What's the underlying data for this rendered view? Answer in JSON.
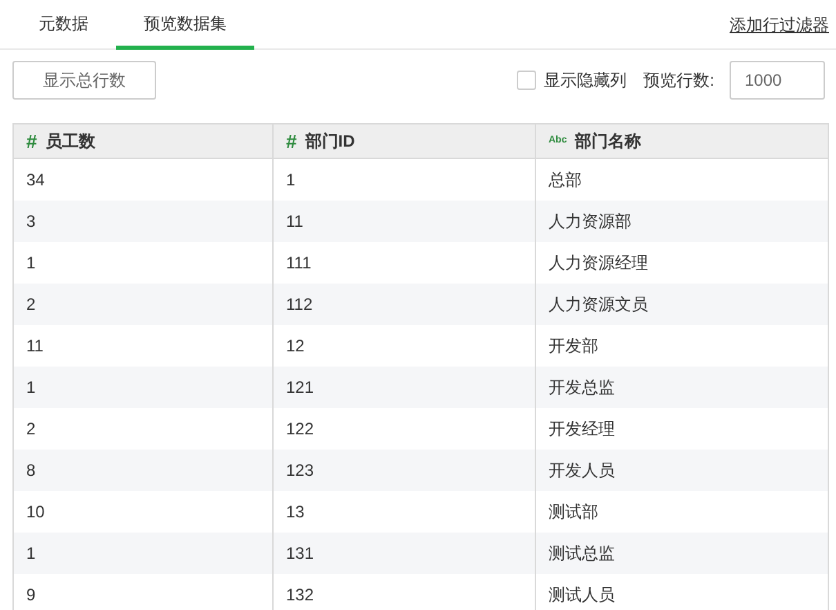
{
  "tabs": [
    {
      "label": "元数据",
      "selected": false
    },
    {
      "label": "预览数据集",
      "selected": true
    }
  ],
  "add_filter_link": "添加行过滤器",
  "toolbar": {
    "show_total_button": "显示总行数",
    "show_hidden_columns": {
      "label": "显示隐藏列",
      "checked": false
    },
    "preview_rows": {
      "label": "预览行数:",
      "value": "1000"
    }
  },
  "table": {
    "columns": [
      {
        "label": "员工数",
        "kind": "number",
        "type_mark": "#"
      },
      {
        "label": "部门ID",
        "kind": "number",
        "type_mark": "#"
      },
      {
        "label": "部门名称",
        "kind": "text",
        "type_mark": "Abc"
      }
    ],
    "rows": [
      [
        "34",
        "1",
        "总部"
      ],
      [
        "3",
        "11",
        "人力资源部"
      ],
      [
        "1",
        "111",
        "人力资源经理"
      ],
      [
        "2",
        "112",
        "人力资源文员"
      ],
      [
        "11",
        "12",
        "开发部"
      ],
      [
        "1",
        "121",
        "开发总监"
      ],
      [
        "2",
        "122",
        "开发经理"
      ],
      [
        "8",
        "123",
        "开发人员"
      ],
      [
        "10",
        "13",
        "测试部"
      ],
      [
        "1",
        "131",
        "测试总监"
      ],
      [
        "9",
        "132",
        "测试人员"
      ]
    ]
  }
}
